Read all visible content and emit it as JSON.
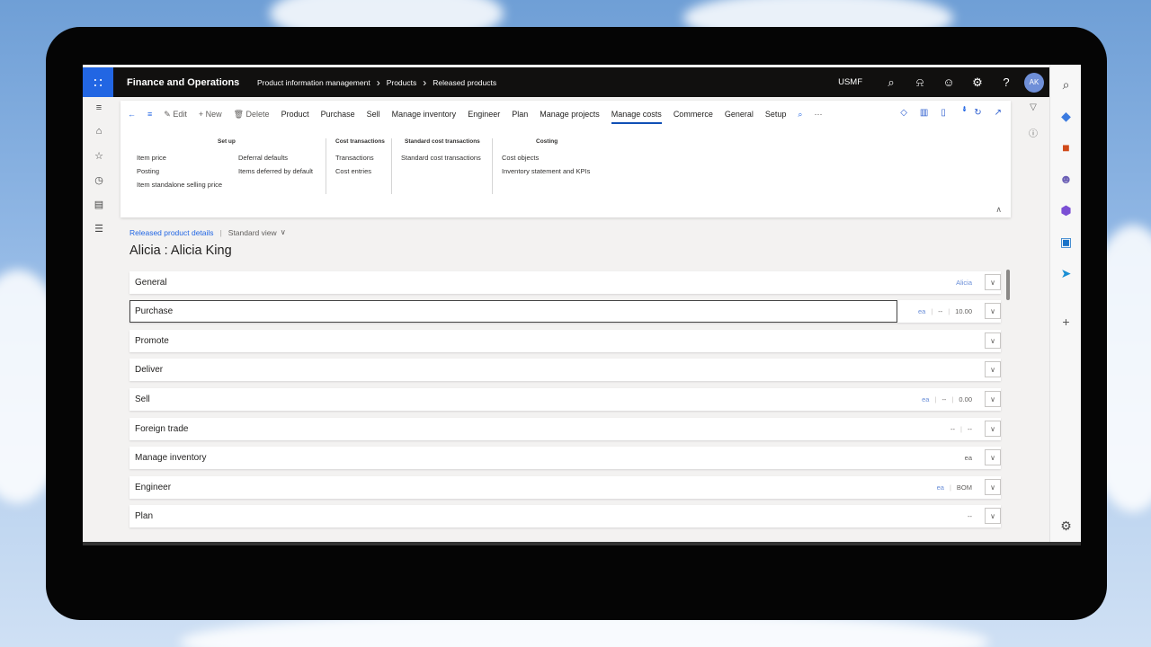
{
  "topbar": {
    "app_title": "Finance and Operations",
    "breadcrumbs": [
      "Product information management",
      "Products",
      "Released products"
    ],
    "company": "USMF",
    "avatar_initials": "AK"
  },
  "action_pane": {
    "tabs": [
      "Edit",
      "New",
      "Delete",
      "Product",
      "Purchase",
      "Sell",
      "Manage inventory",
      "Engineer",
      "Plan",
      "Manage projects",
      "Manage costs",
      "Commerce",
      "General",
      "Setup"
    ],
    "active_tab": "Manage costs",
    "notification_count": "0",
    "groups": {
      "setup": {
        "header": "Set up",
        "col1": [
          "Item price",
          "Posting",
          "Item standalone selling price"
        ],
        "col2": [
          "Deferral defaults",
          "Items deferred by default"
        ]
      },
      "cost_transactions": {
        "header": "Cost transactions",
        "items": [
          "Transactions",
          "Cost entries"
        ]
      },
      "standard_cost": {
        "header": "Standard cost transactions",
        "items": [
          "Standard cost transactions"
        ]
      },
      "costing": {
        "header": "Costing",
        "items": [
          "Cost objects",
          "Inventory statement and KPIs"
        ]
      }
    }
  },
  "details": {
    "link": "Released product details",
    "view": "Standard view",
    "title": "Alicia : Alicia King"
  },
  "fasttabs": [
    {
      "label": "General",
      "summary": [
        "Alicia"
      ]
    },
    {
      "label": "Purchase",
      "summary": [
        "ea",
        "--",
        "10.00"
      ]
    },
    {
      "label": "Promote",
      "summary": []
    },
    {
      "label": "Deliver",
      "summary": []
    },
    {
      "label": "Sell",
      "summary": [
        "ea",
        "--",
        "0.00"
      ]
    },
    {
      "label": "Foreign trade",
      "summary": [
        "--",
        "--"
      ]
    },
    {
      "label": "Manage inventory",
      "summary": [
        "ea"
      ]
    },
    {
      "label": "Engineer",
      "summary": [
        "ea",
        "BOM"
      ]
    },
    {
      "label": "Plan",
      "summary": [
        "--"
      ]
    }
  ]
}
